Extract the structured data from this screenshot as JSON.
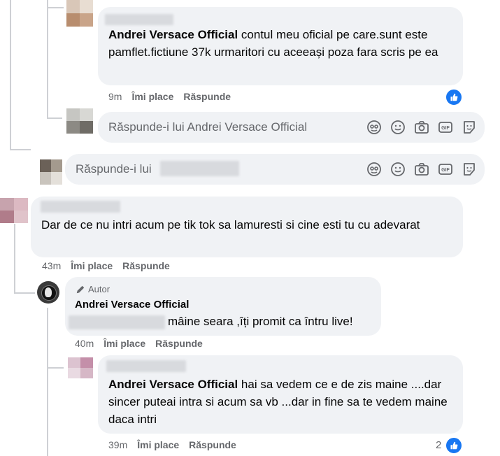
{
  "comments": [
    {
      "author": "Andrei Versace Official",
      "text": " contul meu oficial pe care.sunt este pamflet.fictiune 37k urmaritori cu aceeași poza fara scris pe ea",
      "time": "9m",
      "like_label": "Îmi place",
      "reply_label": "Răspunde"
    },
    {
      "text": "Dar de ce nu intri acum pe tik tok sa lamuresti si cine esti tu cu adevarat",
      "time": "43m",
      "like_label": "Îmi place",
      "reply_label": "Răspunde"
    },
    {
      "badge": "Autor",
      "author": "Andrei Versace Official",
      "text": "mâine seara ,îți promit ca întru live!",
      "time": "40m",
      "like_label": "Îmi place",
      "reply_label": "Răspunde"
    },
    {
      "author": "Andrei Versace Official",
      "text": " hai sa vedem ce e de zis maine ....dar sincer puteai intra si acum sa vb ...dar in fine sa te vedem maine daca intri",
      "time": "39m",
      "like_label": "Îmi place",
      "reply_label": "Răspunde",
      "like_count": "2"
    }
  ],
  "reply_boxes": [
    {
      "placeholder": "Răspunde-i lui Andrei Versace Official"
    },
    {
      "placeholder": "Răspunde-i lui"
    }
  ],
  "composer_icons": [
    "avatar-sticker-icon",
    "emoji-icon",
    "camera-icon",
    "gif-icon",
    "sticker-icon"
  ],
  "colors": {
    "bubble": "#f0f2f5",
    "meta": "#65676b",
    "like_blue": "#1877f2",
    "thread": "#ced0d4"
  }
}
